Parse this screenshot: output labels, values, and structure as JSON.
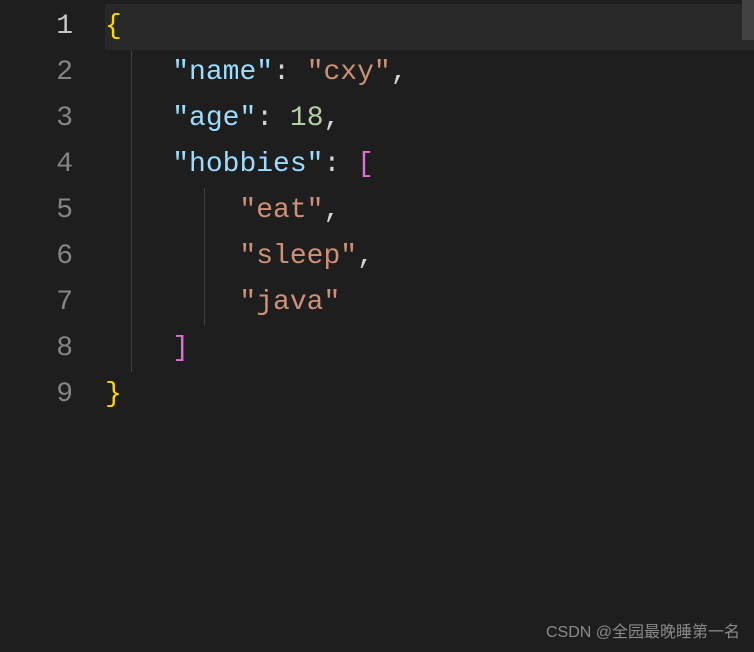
{
  "gutter": {
    "lines": [
      "1",
      "2",
      "3",
      "4",
      "5",
      "6",
      "7",
      "8",
      "9"
    ],
    "active_index": 0
  },
  "code": {
    "l1": {
      "brace": "{"
    },
    "l2": {
      "indent": "    ",
      "q1": "\"",
      "key": "name",
      "q2": "\"",
      "colon": ":",
      "sp": " ",
      "q3": "\"",
      "val": "cxy",
      "q4": "\"",
      "comma": ","
    },
    "l3": {
      "indent": "    ",
      "q1": "\"",
      "key": "age",
      "q2": "\"",
      "colon": ":",
      "sp": " ",
      "val": "18",
      "comma": ","
    },
    "l4": {
      "indent": "    ",
      "q1": "\"",
      "key": "hobbies",
      "q2": "\"",
      "colon": ":",
      "sp": " ",
      "bracket": "["
    },
    "l5": {
      "indent": "        ",
      "q1": "\"",
      "val": "eat",
      "q2": "\"",
      "comma": ","
    },
    "l6": {
      "indent": "        ",
      "q1": "\"",
      "val": "sleep",
      "q2": "\"",
      "comma": ","
    },
    "l7": {
      "indent": "        ",
      "q1": "\"",
      "val": "java",
      "q2": "\""
    },
    "l8": {
      "indent": "    ",
      "bracket": "]"
    },
    "l9": {
      "brace": "}"
    }
  },
  "watermark": "CSDN @全园最晚睡第一名"
}
